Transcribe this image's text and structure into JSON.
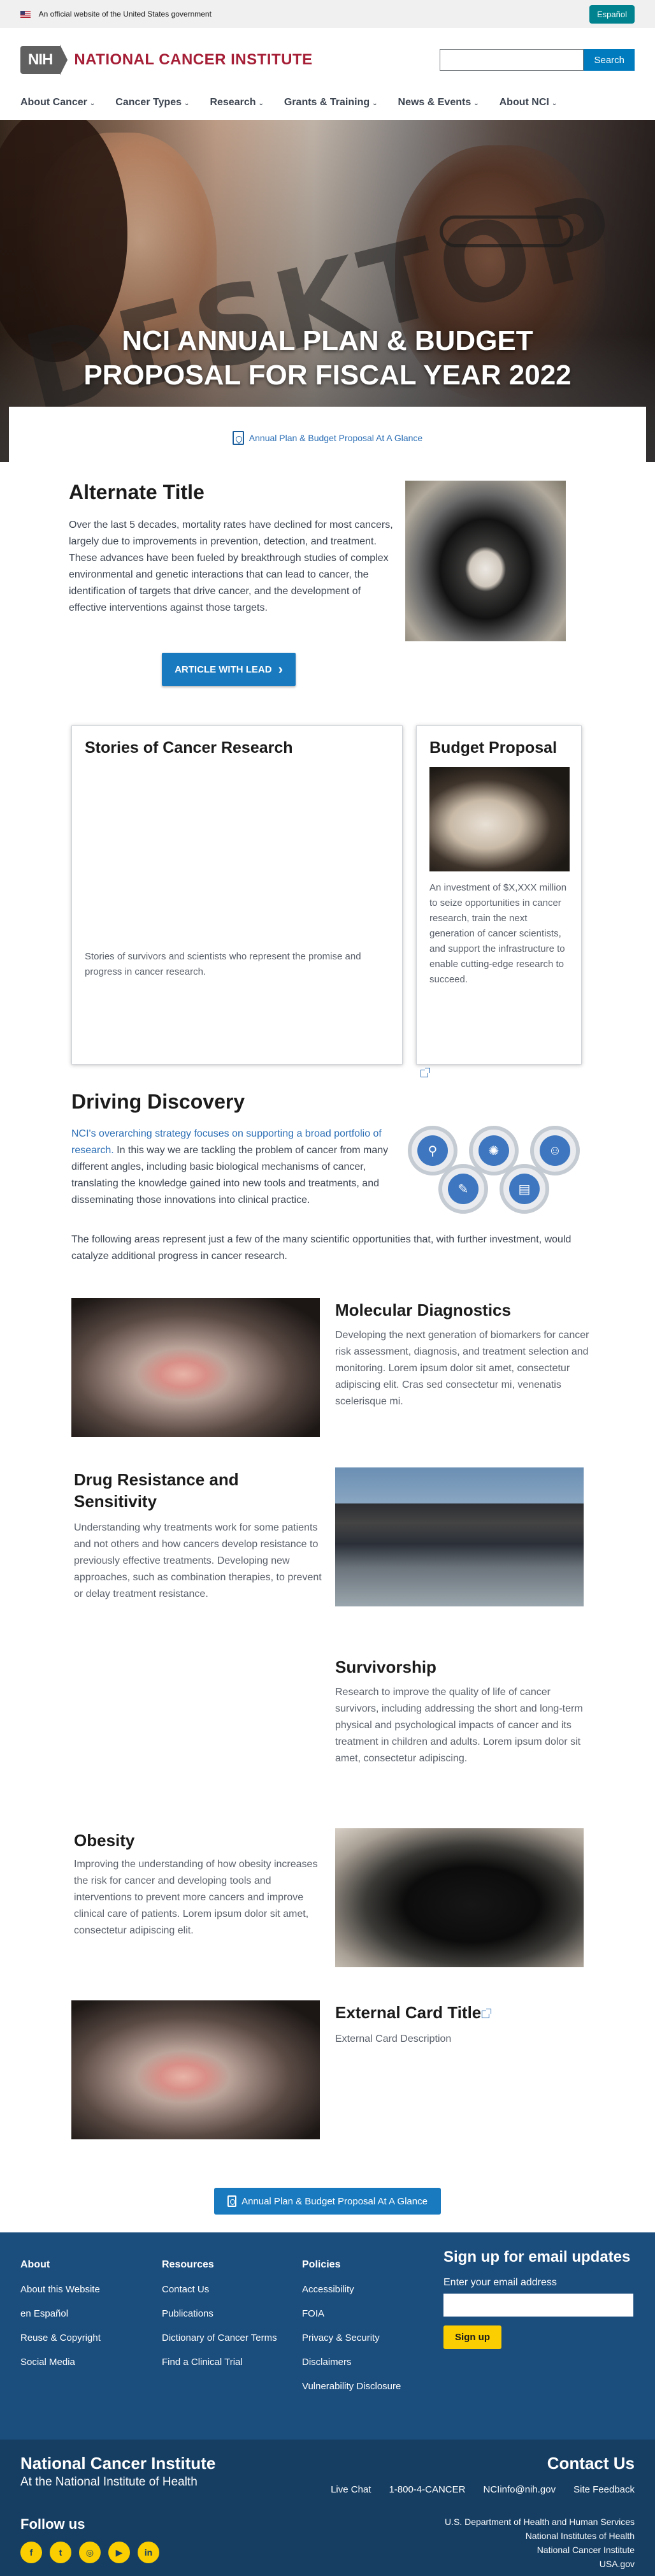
{
  "gov_banner": {
    "text": "An official website of the United States government",
    "espanol": "Español"
  },
  "header": {
    "logo_mark": "NIH",
    "logo_text": "NATIONAL CANCER INSTITUTE",
    "search_placeholder": "",
    "search_button": "Search"
  },
  "nav": [
    "About Cancer",
    "Cancer Types",
    "Research",
    "Grants & Training",
    "News & Events",
    "About NCI"
  ],
  "hero": {
    "watermark": "DESKTOP",
    "title_line1": "NCI ANNUAL PLAN & BUDGET",
    "title_line2": "PROPOSAL FOR FISCAL YEAR 2022"
  },
  "pdf_link": "Annual Plan & Budget Proposal At A Glance",
  "intro": {
    "title": "Alternate Title",
    "body": "Over the last 5 decades, mortality rates have declined for most cancers, largely due to improvements in prevention, detection, and treatment. These advances have been fueled by breakthrough studies of complex environmental and genetic interactions that can lead to cancer, the identification of targets that drive cancer, and the development of effective interventions against those targets.",
    "button": "ARTICLE WITH LEAD"
  },
  "cards": {
    "stories_title": "Stories of Cancer Research",
    "stories_body": "Stories of survivors and scientists who represent the promise and progress in cancer research.",
    "budget_title": "Budget Proposal",
    "budget_body": "An investment of $X,XXX million to seize opportunities in cancer research, train the next generation of cancer scientists, and support the infrastructure to enable cutting-edge research to succeed."
  },
  "discovery": {
    "title": "Driving Discovery",
    "link_text": "NCI's overarching strategy focuses on supporting a broad portfolio of research.",
    "body1": " In this way we are tackling the problem of cancer from many different angles, including basic biological mechanisms of cancer, translating the knowledge gained into new tools and treatments, and disseminating those innovations into clinical practice.",
    "body2": "The following areas represent just a few of the many scientific opportunities that, with further investment, would catalyze additional progress in cancer research."
  },
  "features": {
    "molecular_title": "Molecular Diagnostics",
    "molecular_body": "Developing the next generation of biomarkers for cancer risk assessment, diagnosis, and treatment selection and monitoring. Lorem ipsum dolor sit amet, consectetur adipiscing elit. Cras sed consectetur mi, venenatis scelerisque mi.",
    "drug_title": "Drug Resistance and Sensitivity",
    "drug_body": "Understanding why treatments work for some patients and not others and how cancers develop resistance to previously effective treatments. Developing new approaches, such as combination therapies, to prevent or delay treatment resistance.",
    "surv_title": "Survivorship",
    "surv_body": "Research to improve the quality of life of cancer survivors, including addressing the short and long-term physical and psychological impacts of cancer and its treatment in children and adults. Lorem ipsum dolor sit amet, consectetur adipiscing.",
    "obesity_title": "Obesity",
    "obesity_body": "Improving the understanding of how obesity increases the risk for cancer and developing tools and interventions to prevent more cancers and improve clinical care of patients. Lorem ipsum dolor sit amet, consectetur adipiscing elit.",
    "ext_title": "External Card Title",
    "ext_body": "External Card Description"
  },
  "bottom_button": "Annual Plan & Budget Proposal At A Glance",
  "footer": {
    "about_title": "About",
    "about_links": [
      "About this Website",
      "en Español",
      "Reuse & Copyright",
      "Social Media"
    ],
    "resources_title": "Resources",
    "resources_links": [
      "Contact Us",
      "Publications",
      "Dictionary of Cancer Terms",
      "Find a Clinical Trial"
    ],
    "policies_title": "Policies",
    "policies_links": [
      "Accessibility",
      "FOIA",
      "Privacy & Security",
      "Disclaimers",
      "Vulnerability Disclosure"
    ],
    "signup_title": "Sign up for email updates",
    "signup_label": "Enter your email address",
    "signup_button": "Sign up"
  },
  "subfooter": {
    "name": "National Cancer Institute",
    "sub": "At the National Institute of Health",
    "contact": "Contact Us",
    "links": [
      "Live Chat",
      "1-800-4-CANCER",
      "NCIinfo@nih.gov",
      "Site Feedback"
    ],
    "follow": "Follow us",
    "social": [
      "facebook-icon",
      "twitter-icon",
      "instagram-icon",
      "youtube-icon",
      "linkedin-icon"
    ],
    "gov_lines": [
      "U.S. Department of Health and Human Services",
      "National Institutes of Health",
      "National Cancer Institute",
      "USA.gov"
    ]
  }
}
